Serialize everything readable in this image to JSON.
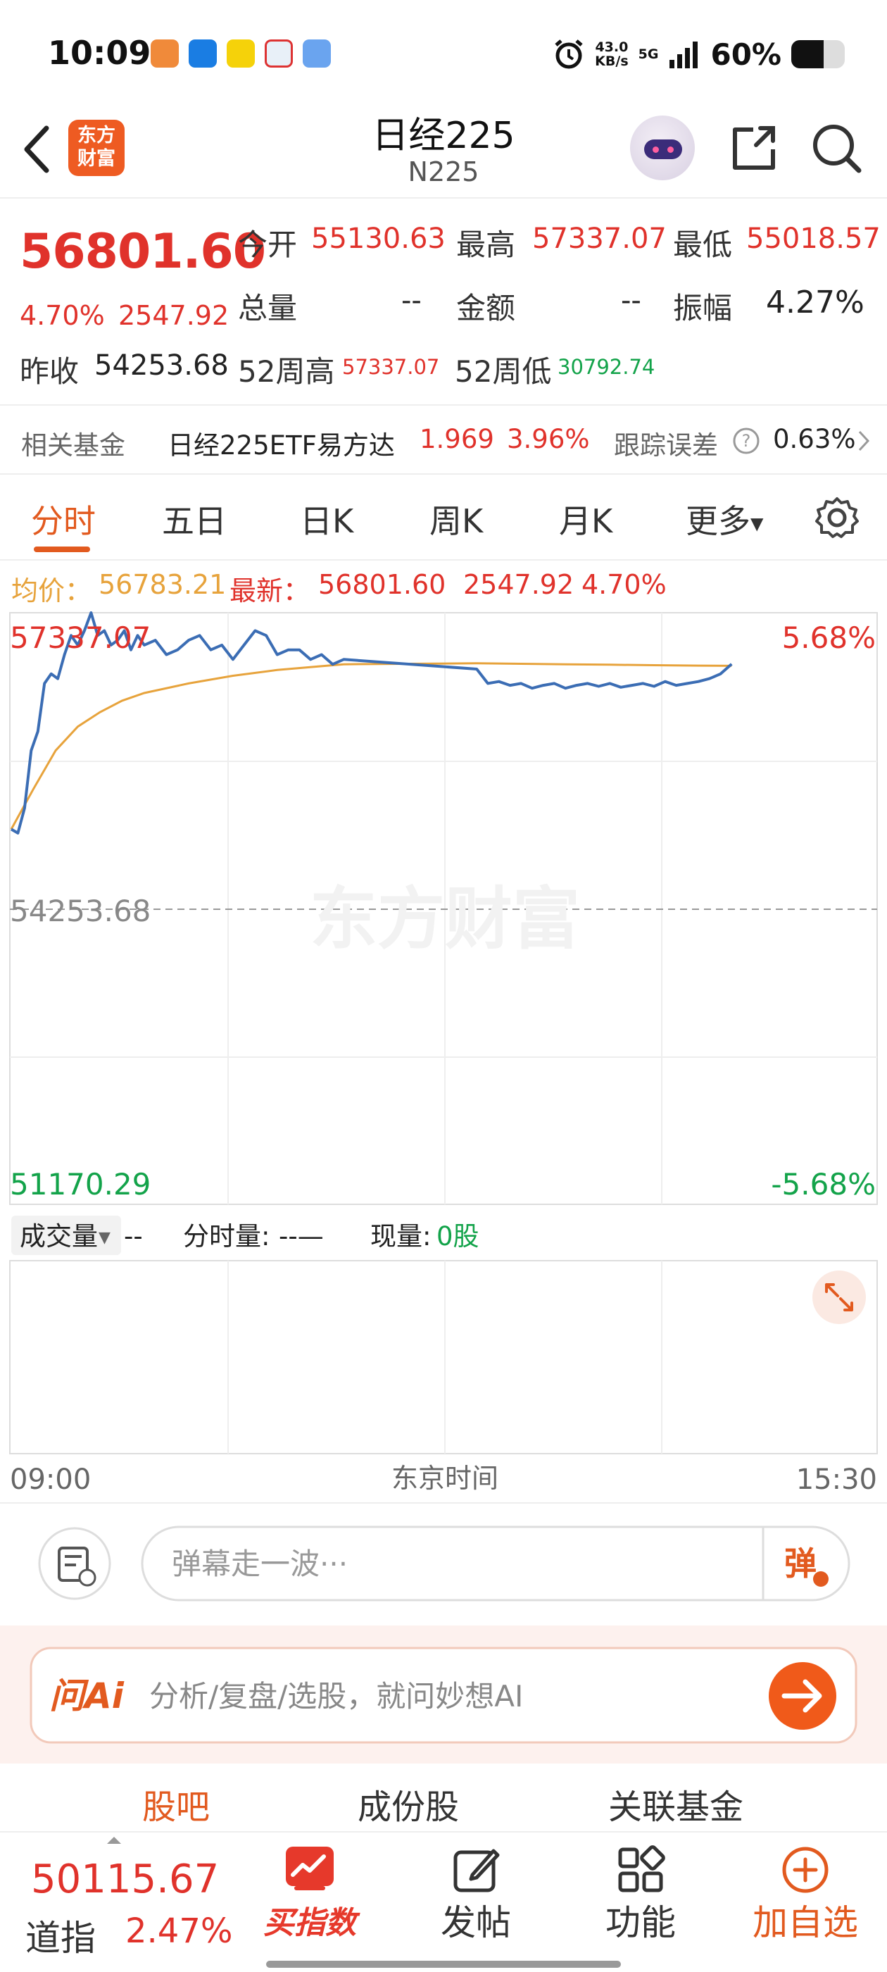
{
  "status_bar": {
    "time": "10:09",
    "net_speed_value": "43.0",
    "net_speed_unit": "KB/s",
    "network": "5G",
    "battery": "60%",
    "battery_level": 0.6
  },
  "header": {
    "title": "日经225",
    "code": "N225",
    "logo_text": "东方财富"
  },
  "quote": {
    "price": "56801.60",
    "change_pct": "4.70%",
    "change": "2547.92",
    "prev_close_label": "昨收",
    "prev_close": "54253.68",
    "open_label": "今开",
    "open": "55130.63",
    "high_label": "最高",
    "high": "57337.07",
    "low_label": "最低",
    "low": "55018.57",
    "volume_label": "总量",
    "volume": "--",
    "amount_label": "金额",
    "amount": "--",
    "amplitude_label": "振幅",
    "amplitude": "4.27%",
    "high52_label": "52周高",
    "high52": "57337.07",
    "low52_label": "52周低",
    "low52": "30792.74"
  },
  "fund": {
    "label": "相关基金",
    "name": "日经225ETF易方达",
    "price": "1.969",
    "change": "3.96%",
    "tracking_label": "跟踪误差",
    "tracking_value": "0.63%"
  },
  "tabs": [
    "分时",
    "五日",
    "日K",
    "周K",
    "月K",
    "更多"
  ],
  "summary": {
    "avg_label": "均价：",
    "avg": "56783.21",
    "latest_label": "最新：",
    "latest": "56801.60",
    "change": "2547.92",
    "change_pct": "4.70%"
  },
  "chart_labels": {
    "top_price": "57337.07",
    "top_pct": "5.68%",
    "mid_price": "54253.68",
    "bottom_price": "51170.29",
    "bottom_pct": "-5.68%",
    "watermark": "东方财富"
  },
  "volume_bar": {
    "selector": "成交量",
    "selector_value": "--",
    "fenshi_label": "分时量:",
    "fenshi_value": "--—",
    "current_label": "现量:",
    "current_value": "0股"
  },
  "time_axis": {
    "start": "09:00",
    "middle": "东京时间",
    "end": "15:30"
  },
  "chart_data": {
    "type": "line",
    "x_start": "09:00",
    "x_end": "15:30",
    "ylim": [
      51170.29,
      57337.07
    ],
    "reference": 54253.68,
    "series": [
      {
        "name": "最新",
        "x": [
          "09:00",
          "09:03",
          "09:06",
          "09:09",
          "09:12",
          "09:15",
          "09:18",
          "09:21",
          "09:24",
          "09:27",
          "09:30",
          "09:33",
          "09:36",
          "09:39",
          "09:42",
          "09:45",
          "09:48",
          "09:51",
          "09:54",
          "09:57",
          "10:00",
          "10:05",
          "10:10",
          "10:15",
          "10:20",
          "10:25",
          "10:30",
          "10:35",
          "10:40",
          "10:45",
          "10:50",
          "10:55",
          "11:00",
          "11:05",
          "11:10",
          "11:15",
          "11:20",
          "11:25",
          "11:30",
          "12:30",
          "12:35",
          "12:40",
          "12:45",
          "12:50",
          "12:55",
          "13:00",
          "13:05",
          "13:10",
          "13:15",
          "13:20",
          "13:25",
          "13:30",
          "13:35",
          "13:40",
          "13:45",
          "13:50",
          "13:55",
          "14:00",
          "14:05",
          "14:10",
          "14:15",
          "14:20",
          "14:25"
        ],
        "values": [
          55080,
          55040,
          55300,
          55900,
          56100,
          56600,
          56700,
          56650,
          56900,
          57100,
          57000,
          57150,
          57337,
          57100,
          57150,
          57000,
          57050,
          57150,
          56950,
          57100,
          57000,
          57050,
          56900,
          56950,
          57050,
          57100,
          56950,
          57000,
          56850,
          57000,
          57150,
          57100,
          56900,
          56950,
          56950,
          56850,
          56900,
          56800,
          56850,
          56750,
          56600,
          56620,
          56580,
          56600,
          56550,
          56580,
          56600,
          56550,
          56580,
          56600,
          56570,
          56600,
          56560,
          56580,
          56600,
          56570,
          56620,
          56580,
          56600,
          56620,
          56650,
          56700,
          56801.6
        ]
      },
      {
        "name": "均价",
        "x": [
          "09:00",
          "09:10",
          "09:20",
          "09:30",
          "09:40",
          "09:50",
          "10:00",
          "10:20",
          "10:40",
          "11:00",
          "11:20",
          "11:30",
          "12:30",
          "12:50",
          "13:10",
          "13:30",
          "13:50",
          "14:10",
          "14:25"
        ],
        "values": [
          55080,
          55500,
          55900,
          56150,
          56300,
          56420,
          56500,
          56600,
          56680,
          56740,
          56780,
          56800,
          56810,
          56805,
          56800,
          56795,
          56790,
          56786,
          56783.21
        ]
      }
    ]
  },
  "comment_bar": {
    "placeholder": "弹幕走一波···",
    "danmu_label": "弹"
  },
  "ai_bar": {
    "brand": "问Ai",
    "placeholder": "分析/复盘/选股，就问妙想AI"
  },
  "sub_tabs": [
    "股吧",
    "成份股",
    "关联基金"
  ],
  "bottom_nav": {
    "index_value": "50115.67",
    "index_name": "道指",
    "index_change": "2.47%",
    "buy_index": "买指数",
    "post": "发帖",
    "function": "功能",
    "add_watch": "加自选"
  },
  "colors": {
    "accent": "#e25a1f",
    "up": "#e0322b",
    "down": "#13a34a",
    "price_line": "#3b6db4",
    "avg_line": "#e7a33c"
  }
}
